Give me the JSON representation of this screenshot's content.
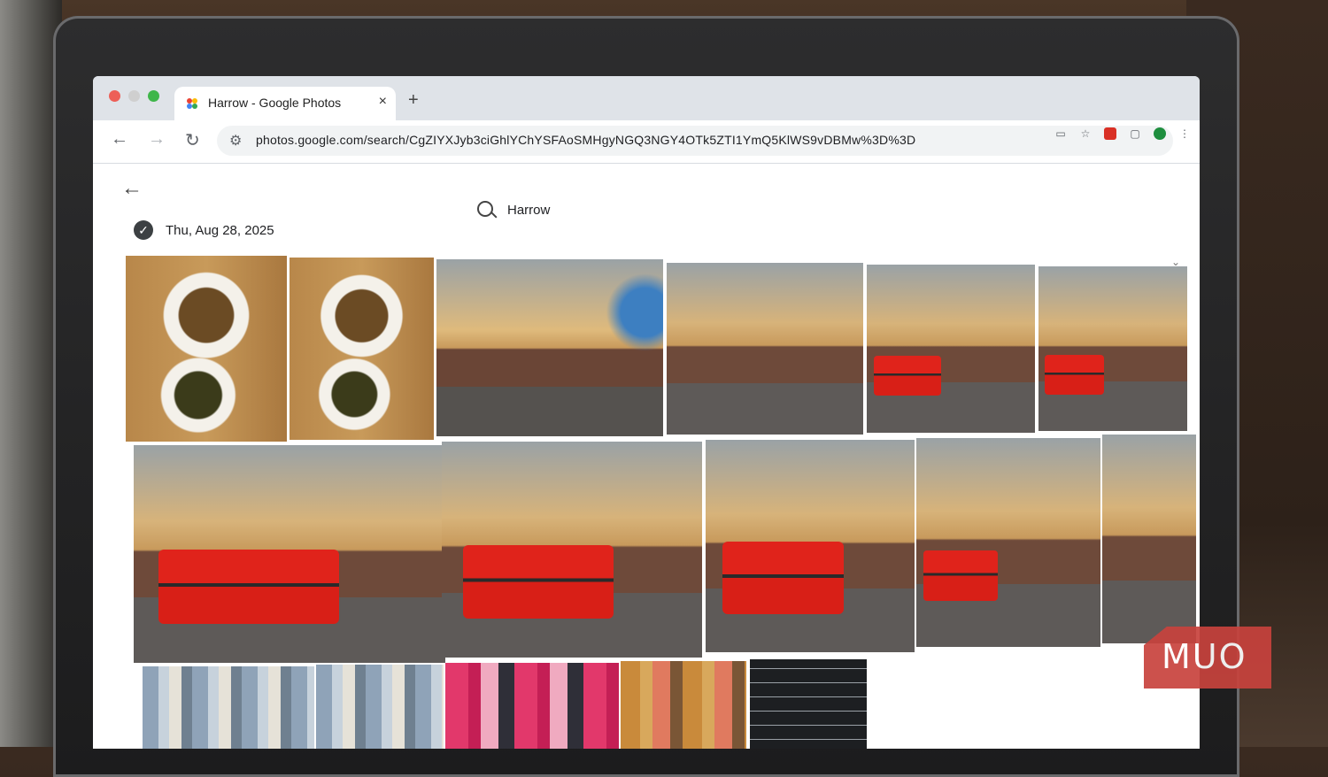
{
  "browser": {
    "tab_title": "Harrow - Google Photos",
    "tab_close": "×",
    "new_tab": "+",
    "back": "←",
    "forward": "→",
    "reload": "↻",
    "url": "photos.google.com/search/CgZIYXJyb3ciGhlYChYSFAoSMHgyNGQ3NGY4OTk5ZTI1YmQ5KlWS9vDBMw%3D%3D"
  },
  "app": {
    "back": "←",
    "search_query": "Harrow",
    "date_heading": "Thu, Aug 28, 2025",
    "check": "✓"
  },
  "watermark": "MUO"
}
